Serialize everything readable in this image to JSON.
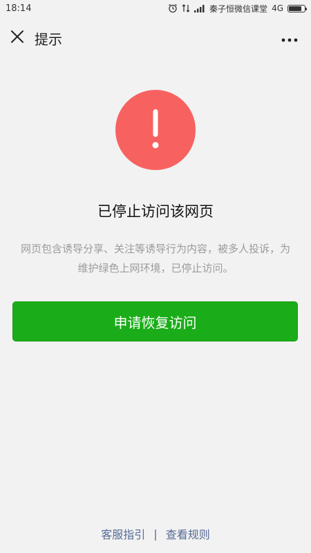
{
  "status_bar": {
    "time": "18:14",
    "carrier": "秦子恒微信课堂",
    "network": "4G",
    "battery_level": 0.8
  },
  "nav": {
    "title": "提示"
  },
  "main": {
    "headline": "已停止访问该网页",
    "description": "网页包含诱导分享、关注等诱导行为内容，被多人投诉，为维护绿色上网环境，已停止访问。",
    "appeal_button_label": "申请恢复访问",
    "warning_color": "#f76260",
    "button_color": "#1aad19"
  },
  "footer": {
    "guide_link": "客服指引",
    "separator": "|",
    "rules_link": "查看规则"
  }
}
